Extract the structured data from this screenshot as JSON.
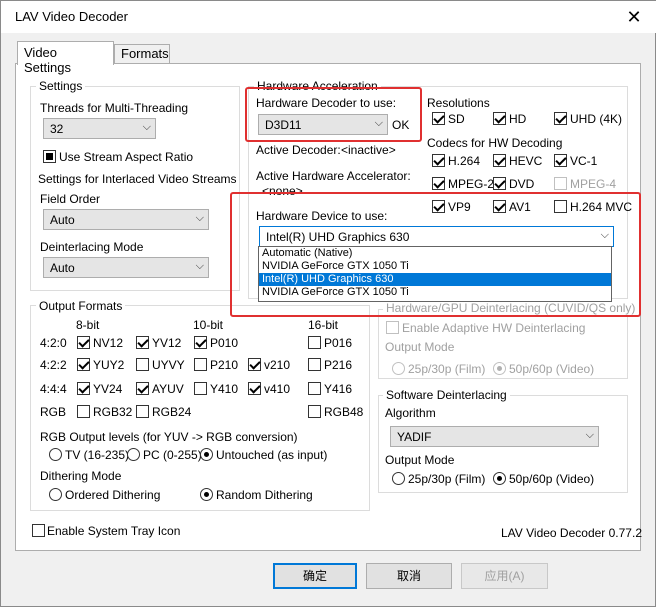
{
  "window": {
    "title": "LAV Video Decoder",
    "close_icon": "close-icon"
  },
  "tabs": [
    {
      "label": "Video Settings",
      "active": true
    },
    {
      "label": "Formats",
      "active": false
    }
  ],
  "settings": {
    "group_label": "Settings",
    "threads_label": "Threads for Multi-Threading",
    "threads_value": "32",
    "stream_aspect_label": "Use Stream Aspect Ratio",
    "stream_aspect_state": "indeterminate",
    "interlaced_label": "Settings for Interlaced Video Streams",
    "field_order_label": "Field Order",
    "field_order_value": "Auto",
    "deint_mode_label": "Deinterlacing Mode",
    "deint_mode_value": "Auto"
  },
  "hwaccel": {
    "group_label": "Hardware Acceleration",
    "decoder_label": "Hardware Decoder to use:",
    "decoder_value": "D3D11",
    "decoder_status": "OK",
    "active_decoder_label": "Active Decoder:",
    "active_decoder_value": "<inactive>",
    "active_accel_label": "Active Hardware Accelerator:",
    "active_accel_value": "<none>",
    "device_label": "Hardware Device to use:",
    "device_value": "Intel(R) UHD Graphics 630",
    "device_options": [
      "Automatic (Native)",
      "NVIDIA GeForce GTX 1050 Ti",
      "Intel(R) UHD Graphics 630",
      "NVIDIA GeForce GTX 1050 Ti"
    ],
    "device_selected_index": 2,
    "resolutions_label": "Resolutions",
    "resolutions": [
      {
        "label": "SD",
        "checked": true
      },
      {
        "label": "HD",
        "checked": true
      },
      {
        "label": "UHD (4K)",
        "checked": true
      }
    ],
    "codecs_label": "Codecs for HW Decoding",
    "codecs": [
      {
        "label": "H.264",
        "checked": true,
        "enabled": true
      },
      {
        "label": "HEVC",
        "checked": true,
        "enabled": true
      },
      {
        "label": "VC-1",
        "checked": true,
        "enabled": true
      },
      {
        "label": "MPEG-2",
        "checked": true,
        "enabled": true
      },
      {
        "label": "DVD",
        "checked": true,
        "enabled": true
      },
      {
        "label": "MPEG-4",
        "checked": false,
        "enabled": false
      },
      {
        "label": "VP9",
        "checked": true,
        "enabled": true
      },
      {
        "label": "AV1",
        "checked": true,
        "enabled": true
      },
      {
        "label": "H.264 MVC",
        "checked": false,
        "enabled": true
      }
    ]
  },
  "output_formats": {
    "group_label": "Output Formats",
    "col_8bit": "8-bit",
    "col_10bit": "10-bit",
    "col_16bit": "16-bit",
    "row_420": "4:2:0",
    "row_422": "4:2:2",
    "row_444": "4:4:4",
    "row_rgb": "RGB",
    "f_420": [
      {
        "label": "NV12",
        "checked": true
      },
      {
        "label": "YV12",
        "checked": true
      },
      {
        "label": "P010",
        "checked": true
      },
      {
        "label": "P016",
        "checked": false
      }
    ],
    "f_422": [
      {
        "label": "YUY2",
        "checked": true
      },
      {
        "label": "UYVY",
        "checked": false
      },
      {
        "label": "P210",
        "checked": false
      },
      {
        "label": "v210",
        "checked": true
      },
      {
        "label": "P216",
        "checked": false
      }
    ],
    "f_444": [
      {
        "label": "YV24",
        "checked": true
      },
      {
        "label": "AYUV",
        "checked": true
      },
      {
        "label": "Y410",
        "checked": false
      },
      {
        "label": "v410",
        "checked": true
      },
      {
        "label": "Y416",
        "checked": false
      }
    ],
    "f_rgb": [
      {
        "label": "RGB32",
        "checked": false
      },
      {
        "label": "RGB24",
        "checked": false
      },
      {
        "label": "RGB48",
        "checked": false
      }
    ],
    "rgb_levels_label": "RGB Output levels (for YUV -> RGB conversion)",
    "rgb_levels": [
      {
        "label": "TV (16-235)",
        "selected": false
      },
      {
        "label": "PC (0-255)",
        "selected": false
      },
      {
        "label": "Untouched (as input)",
        "selected": true
      }
    ],
    "dither_label": "Dithering Mode",
    "dither": [
      {
        "label": "Ordered Dithering",
        "selected": false
      },
      {
        "label": "Random Dithering",
        "selected": true
      }
    ]
  },
  "hw_deint": {
    "group_label": "Hardware/GPU Deinterlacing (CUVID/QS only)",
    "adaptive_label": "Enable Adaptive HW Deinterlacing",
    "output_mode_label": "Output Mode",
    "modes": [
      {
        "label": "25p/30p (Film)",
        "selected": false
      },
      {
        "label": "50p/60p (Video)",
        "selected": true
      }
    ]
  },
  "sw_deint": {
    "group_label": "Software Deinterlacing",
    "algorithm_label": "Algorithm",
    "algorithm_value": "YADIF",
    "output_mode_label": "Output Mode",
    "modes": [
      {
        "label": "25p/30p (Film)",
        "selected": false
      },
      {
        "label": "50p/60p (Video)",
        "selected": true
      }
    ]
  },
  "tray_label": "Enable System Tray Icon",
  "version": "LAV Video Decoder 0.77.2",
  "buttons": {
    "ok": "确定",
    "cancel": "取消",
    "apply": "应用(A)"
  },
  "highlight_color": "#e03030"
}
